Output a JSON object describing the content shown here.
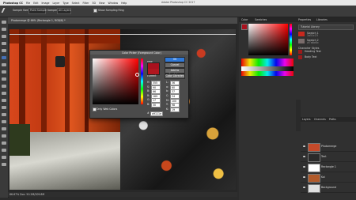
{
  "menubar": {
    "items": [
      "Photoshop CC",
      "File",
      "Edit",
      "Image",
      "Layer",
      "Type",
      "Select",
      "Filter",
      "3D",
      "View",
      "Window",
      "Help"
    ],
    "title": "Adobe Photoshop CC 2017"
  },
  "optionbar": {
    "sample_size_label": "Sample Size:",
    "sample_size_value": "Point Sample",
    "sample_label": "Sample:",
    "sample_value": "All Layers",
    "show_ring_label": "Show Sampling Ring"
  },
  "document": {
    "tab": "Photomerge @ 66% (Rectangle 1, RGB/8) *",
    "status": "66.67%    Doc: 50.2M/209.8M"
  },
  "panels": {
    "top_tabs": [
      "Color",
      "Swatches"
    ],
    "mid_tabs": [
      "Properties",
      "Libraries"
    ],
    "layers_tabs": [
      "Layers",
      "Channels",
      "Paths"
    ],
    "library_name": "Tutorial Library",
    "library_items": [
      "Swatch 1",
      "1a51c23",
      "Swatch 2",
      "#7a6c6b"
    ],
    "library_section": "Character Styles",
    "library_char_items": [
      "Heading Text",
      "Body Text"
    ]
  },
  "layers": [
    {
      "name": "Photomerge",
      "thumb": "#c54a2a",
      "visible": true
    },
    {
      "name": "Text",
      "thumb": "#2a2a2a",
      "visible": true
    },
    {
      "name": "Rectangle 1",
      "thumb": "#ffffff",
      "visible": true
    },
    {
      "name": "Koi",
      "thumb": "#b15a2a",
      "visible": true
    },
    {
      "name": "Background",
      "thumb": "#e0e0e0",
      "visible": true
    }
  ],
  "dialog": {
    "title": "Color Picker (Foreground Color)",
    "ok": "OK",
    "cancel": "Cancel",
    "add_swatches": "Add to Swatches",
    "color_libraries": "Color Libraries",
    "new_label": "new",
    "current_label": "current",
    "only_web": "Only Web Colors",
    "fields": [
      {
        "label": "H:",
        "value": "355"
      },
      {
        "label": "S:",
        "value": "90"
      },
      {
        "label": "B:",
        "value": "66"
      },
      {
        "label": "R:",
        "value": "169"
      },
      {
        "label": "G:",
        "value": "17"
      },
      {
        "label": "B:",
        "value": "30"
      }
    ],
    "hex_label": "#",
    "hex_value": "a9111e",
    "cmyk": [
      {
        "label": "C:",
        "value": "24"
      },
      {
        "label": "M:",
        "value": "100"
      },
      {
        "label": "Y:",
        "value": "98"
      },
      {
        "label": "K:",
        "value": "19"
      }
    ],
    "lab": [
      {
        "label": "L:",
        "value": "36"
      },
      {
        "label": "a:",
        "value": "60"
      },
      {
        "label": "b:",
        "value": "37"
      }
    ],
    "color": "#a9111e"
  }
}
